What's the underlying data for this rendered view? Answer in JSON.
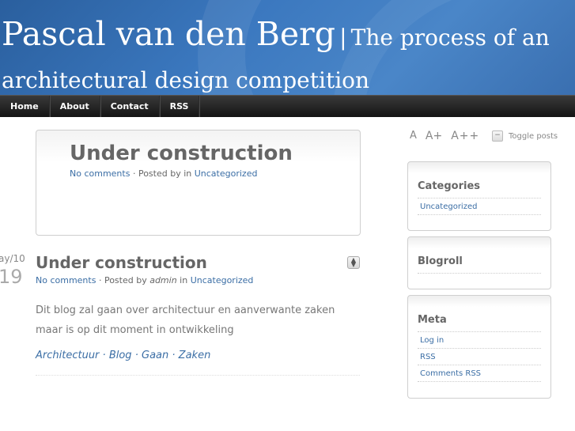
{
  "header": {
    "site_name": "Pascal van den Berg",
    "separator": "|",
    "tagline": "The process of an architectural design competition"
  },
  "nav": {
    "items": [
      "Home",
      "About",
      "Contact",
      "RSS"
    ]
  },
  "sticky_post": {
    "title": "Under construction",
    "comments": "No comments",
    "posted_by": "· Posted by  in",
    "category": "Uncategorized"
  },
  "post": {
    "date_month": "ay/10",
    "date_day": "19",
    "title": "Under construction",
    "comments": "No comments",
    "posted_by_prefix": "· Posted by",
    "author": "admin",
    "in_word": "in",
    "category": "Uncategorized",
    "body": "Dit blog zal gaan over architectuur en aanverwante zaken maar is op dit moment in ontwikkeling",
    "tags": [
      "Architectuur",
      "Blog",
      "Gaan",
      "Zaken"
    ],
    "tag_separator": "·"
  },
  "sidebar": {
    "font_sizes": [
      "A",
      "A+",
      "A++"
    ],
    "toggle_label": "Toggle posts",
    "toggle_icon": "minus-icon",
    "widgets": {
      "categories": {
        "title": "Categories",
        "items": [
          "Uncategorized"
        ]
      },
      "blogroll": {
        "title": "Blogroll"
      },
      "meta": {
        "title": "Meta",
        "items": [
          "Log in",
          "RSS",
          "Comments RSS"
        ]
      }
    }
  },
  "colors": {
    "header_blue": "#3b78bf",
    "nav_dark": "#1e1e1e",
    "link": "#3b6ea5"
  }
}
